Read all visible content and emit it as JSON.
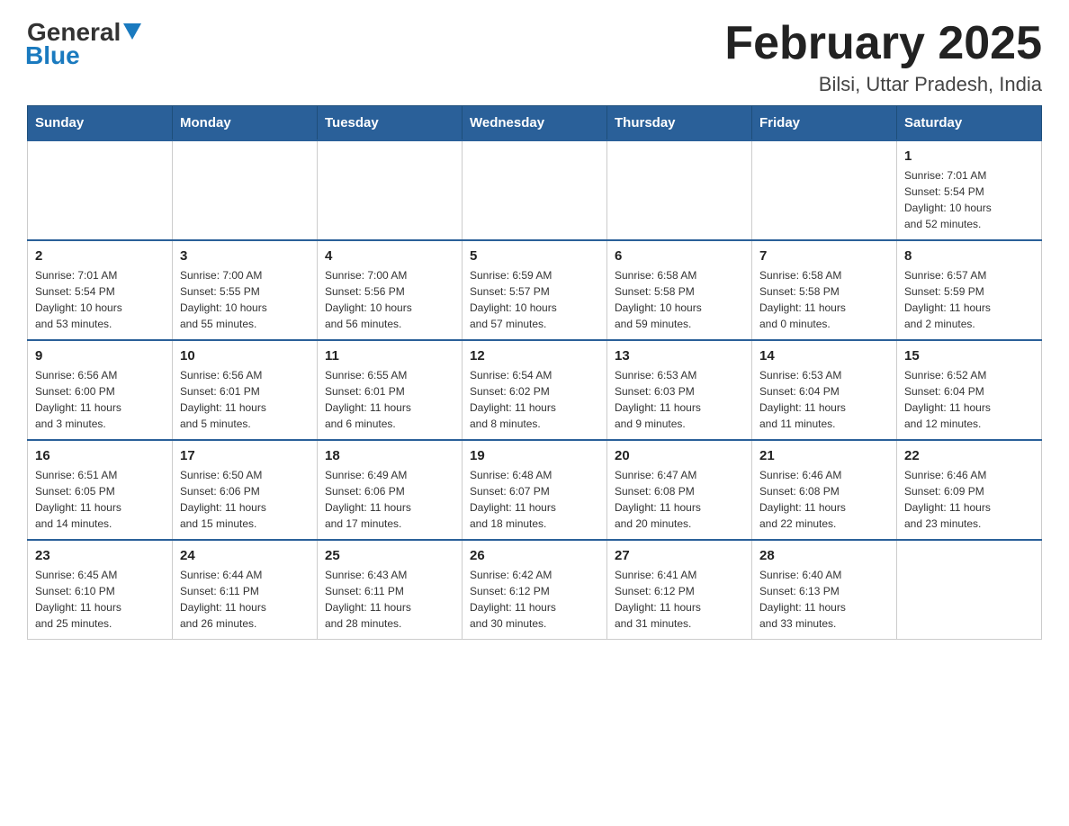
{
  "header": {
    "logo_general": "General",
    "logo_blue": "Blue",
    "month": "February 2025",
    "location": "Bilsi, Uttar Pradesh, India"
  },
  "days_of_week": [
    "Sunday",
    "Monday",
    "Tuesday",
    "Wednesday",
    "Thursday",
    "Friday",
    "Saturday"
  ],
  "weeks": [
    [
      {
        "day": "",
        "info": ""
      },
      {
        "day": "",
        "info": ""
      },
      {
        "day": "",
        "info": ""
      },
      {
        "day": "",
        "info": ""
      },
      {
        "day": "",
        "info": ""
      },
      {
        "day": "",
        "info": ""
      },
      {
        "day": "1",
        "info": "Sunrise: 7:01 AM\nSunset: 5:54 PM\nDaylight: 10 hours\nand 52 minutes."
      }
    ],
    [
      {
        "day": "2",
        "info": "Sunrise: 7:01 AM\nSunset: 5:54 PM\nDaylight: 10 hours\nand 53 minutes."
      },
      {
        "day": "3",
        "info": "Sunrise: 7:00 AM\nSunset: 5:55 PM\nDaylight: 10 hours\nand 55 minutes."
      },
      {
        "day": "4",
        "info": "Sunrise: 7:00 AM\nSunset: 5:56 PM\nDaylight: 10 hours\nand 56 minutes."
      },
      {
        "day": "5",
        "info": "Sunrise: 6:59 AM\nSunset: 5:57 PM\nDaylight: 10 hours\nand 57 minutes."
      },
      {
        "day": "6",
        "info": "Sunrise: 6:58 AM\nSunset: 5:58 PM\nDaylight: 10 hours\nand 59 minutes."
      },
      {
        "day": "7",
        "info": "Sunrise: 6:58 AM\nSunset: 5:58 PM\nDaylight: 11 hours\nand 0 minutes."
      },
      {
        "day": "8",
        "info": "Sunrise: 6:57 AM\nSunset: 5:59 PM\nDaylight: 11 hours\nand 2 minutes."
      }
    ],
    [
      {
        "day": "9",
        "info": "Sunrise: 6:56 AM\nSunset: 6:00 PM\nDaylight: 11 hours\nand 3 minutes."
      },
      {
        "day": "10",
        "info": "Sunrise: 6:56 AM\nSunset: 6:01 PM\nDaylight: 11 hours\nand 5 minutes."
      },
      {
        "day": "11",
        "info": "Sunrise: 6:55 AM\nSunset: 6:01 PM\nDaylight: 11 hours\nand 6 minutes."
      },
      {
        "day": "12",
        "info": "Sunrise: 6:54 AM\nSunset: 6:02 PM\nDaylight: 11 hours\nand 8 minutes."
      },
      {
        "day": "13",
        "info": "Sunrise: 6:53 AM\nSunset: 6:03 PM\nDaylight: 11 hours\nand 9 minutes."
      },
      {
        "day": "14",
        "info": "Sunrise: 6:53 AM\nSunset: 6:04 PM\nDaylight: 11 hours\nand 11 minutes."
      },
      {
        "day": "15",
        "info": "Sunrise: 6:52 AM\nSunset: 6:04 PM\nDaylight: 11 hours\nand 12 minutes."
      }
    ],
    [
      {
        "day": "16",
        "info": "Sunrise: 6:51 AM\nSunset: 6:05 PM\nDaylight: 11 hours\nand 14 minutes."
      },
      {
        "day": "17",
        "info": "Sunrise: 6:50 AM\nSunset: 6:06 PM\nDaylight: 11 hours\nand 15 minutes."
      },
      {
        "day": "18",
        "info": "Sunrise: 6:49 AM\nSunset: 6:06 PM\nDaylight: 11 hours\nand 17 minutes."
      },
      {
        "day": "19",
        "info": "Sunrise: 6:48 AM\nSunset: 6:07 PM\nDaylight: 11 hours\nand 18 minutes."
      },
      {
        "day": "20",
        "info": "Sunrise: 6:47 AM\nSunset: 6:08 PM\nDaylight: 11 hours\nand 20 minutes."
      },
      {
        "day": "21",
        "info": "Sunrise: 6:46 AM\nSunset: 6:08 PM\nDaylight: 11 hours\nand 22 minutes."
      },
      {
        "day": "22",
        "info": "Sunrise: 6:46 AM\nSunset: 6:09 PM\nDaylight: 11 hours\nand 23 minutes."
      }
    ],
    [
      {
        "day": "23",
        "info": "Sunrise: 6:45 AM\nSunset: 6:10 PM\nDaylight: 11 hours\nand 25 minutes."
      },
      {
        "day": "24",
        "info": "Sunrise: 6:44 AM\nSunset: 6:11 PM\nDaylight: 11 hours\nand 26 minutes."
      },
      {
        "day": "25",
        "info": "Sunrise: 6:43 AM\nSunset: 6:11 PM\nDaylight: 11 hours\nand 28 minutes."
      },
      {
        "day": "26",
        "info": "Sunrise: 6:42 AM\nSunset: 6:12 PM\nDaylight: 11 hours\nand 30 minutes."
      },
      {
        "day": "27",
        "info": "Sunrise: 6:41 AM\nSunset: 6:12 PM\nDaylight: 11 hours\nand 31 minutes."
      },
      {
        "day": "28",
        "info": "Sunrise: 6:40 AM\nSunset: 6:13 PM\nDaylight: 11 hours\nand 33 minutes."
      },
      {
        "day": "",
        "info": ""
      }
    ]
  ]
}
